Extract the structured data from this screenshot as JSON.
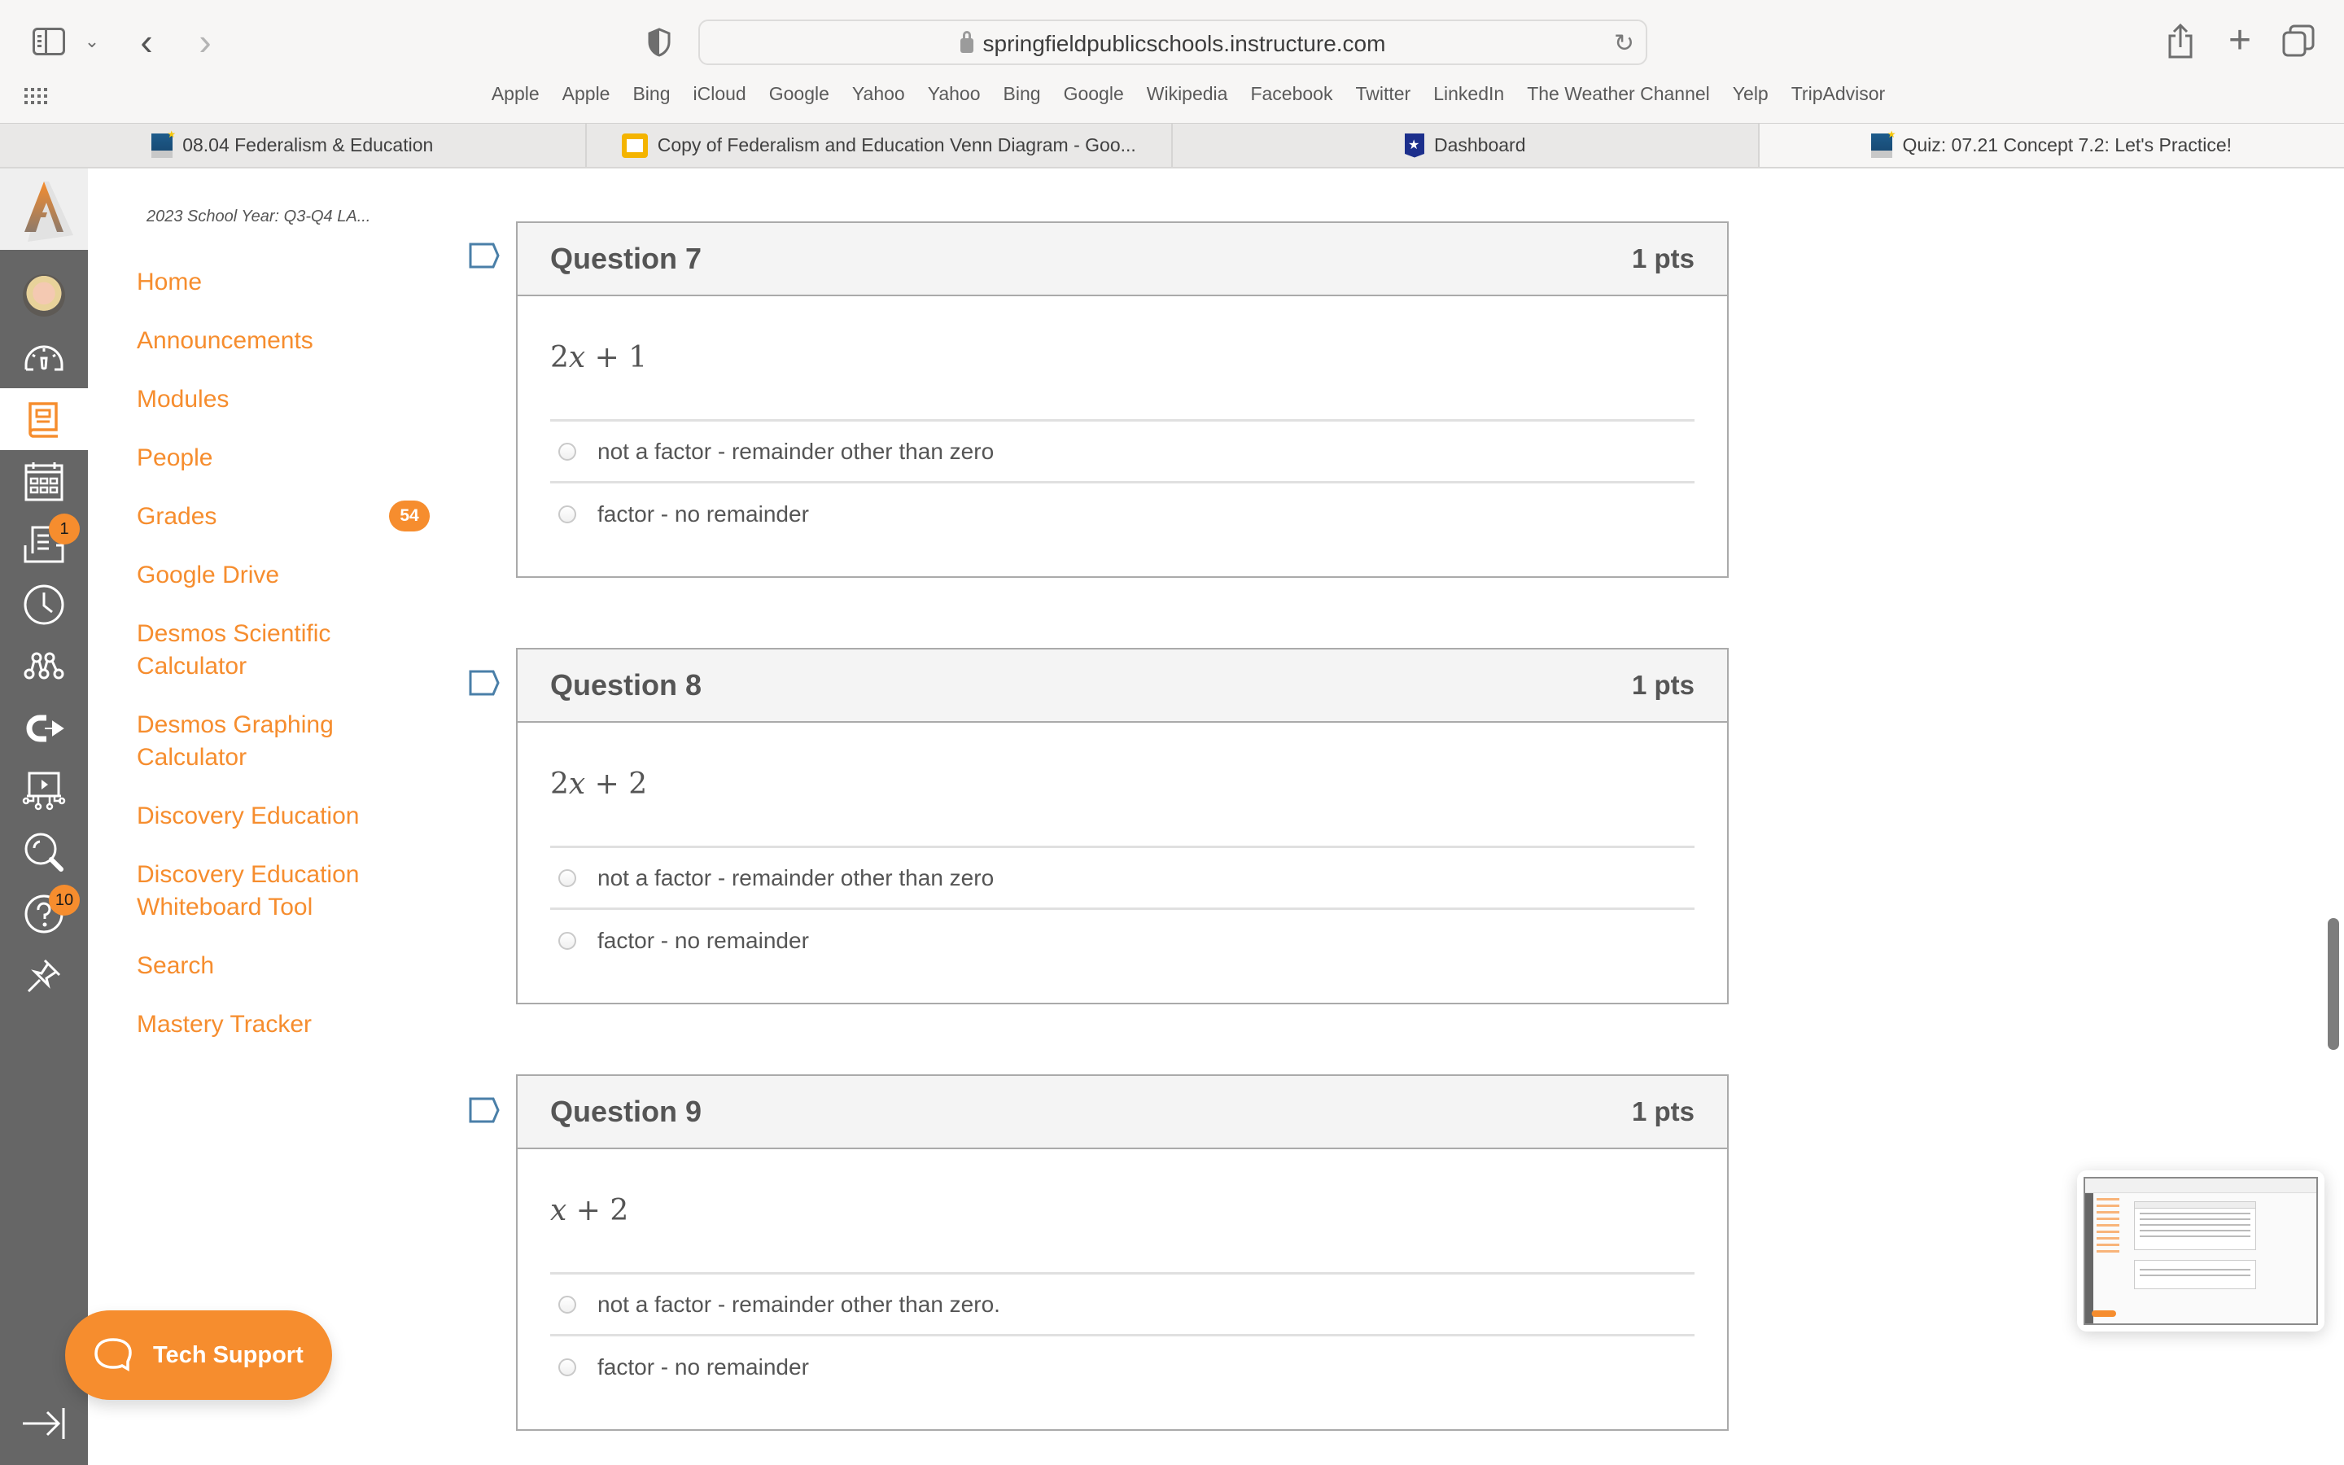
{
  "browser": {
    "url": "springfieldpublicschools.instructure.com",
    "bookmarks": [
      "Apple",
      "Apple",
      "Bing",
      "iCloud",
      "Google",
      "Yahoo",
      "Yahoo",
      "Bing",
      "Google",
      "Wikipedia",
      "Facebook",
      "Twitter",
      "LinkedIn",
      "The Weather Channel",
      "Yelp",
      "TripAdvisor"
    ],
    "tabs": [
      {
        "title": "08.04 Federalism & Education",
        "favicon": "springfield-schools-icon",
        "active": false
      },
      {
        "title": "Copy of Federalism and Education Venn Diagram - Goo...",
        "favicon": "google-slides-icon",
        "active": false
      },
      {
        "title": "Dashboard",
        "favicon": "canvas-shield-icon",
        "active": false
      },
      {
        "title": "Quiz: 07.21 Concept 7.2: Let's Practice!",
        "favicon": "springfield-schools-icon",
        "active": true
      }
    ]
  },
  "global_nav": {
    "items": [
      {
        "name": "account",
        "icon": "avatar"
      },
      {
        "name": "dashboard",
        "icon": "dashboard-gauge-icon"
      },
      {
        "name": "courses",
        "icon": "courses-book-icon",
        "active": true
      },
      {
        "name": "calendar",
        "icon": "calendar-icon"
      },
      {
        "name": "inbox",
        "icon": "inbox-icon",
        "badge": "1"
      },
      {
        "name": "history",
        "icon": "clock-icon"
      },
      {
        "name": "groups",
        "icon": "groups-icon"
      },
      {
        "name": "external-tool",
        "icon": "magnet-arrow-icon"
      },
      {
        "name": "studio",
        "icon": "studio-icon"
      },
      {
        "name": "search",
        "icon": "search-icon"
      },
      {
        "name": "help",
        "icon": "help-icon",
        "badge": "10"
      },
      {
        "name": "pin",
        "icon": "pin-icon"
      }
    ]
  },
  "course_nav": {
    "course_title": "2023 School Year: Q3-Q4 LA...",
    "items": [
      {
        "label": "Home"
      },
      {
        "label": "Announcements"
      },
      {
        "label": "Modules"
      },
      {
        "label": "People"
      },
      {
        "label": "Grades",
        "badge": "54"
      },
      {
        "label": "Google Drive"
      },
      {
        "label": "Desmos Scientific Calculator"
      },
      {
        "label": "Desmos Graphing Calculator"
      },
      {
        "label": "Discovery Education"
      },
      {
        "label": "Discovery Education Whiteboard Tool"
      },
      {
        "label": "Search"
      },
      {
        "label": "Mastery Tracker"
      }
    ]
  },
  "questions": [
    {
      "title": "Question 7",
      "points": "1 pts",
      "expression": {
        "coef": "2",
        "var": "x",
        "op": "+",
        "const": "1"
      },
      "answers": [
        "not a factor - remainder other than zero",
        "factor - no remainder"
      ]
    },
    {
      "title": "Question 8",
      "points": "1 pts",
      "expression": {
        "coef": "2",
        "var": "x",
        "op": "+",
        "const": "2"
      },
      "answers": [
        "not a factor - remainder other than zero",
        "factor - no remainder"
      ]
    },
    {
      "title": "Question 9",
      "points": "1 pts",
      "expression": {
        "coef": "",
        "var": "x",
        "op": "+",
        "const": "2"
      },
      "answers": [
        "not a factor - remainder other than zero.",
        "factor - no remainder"
      ]
    }
  ],
  "tech_support": {
    "label": "Tech Support"
  },
  "colors": {
    "brand_orange": "#f68d2e",
    "nav_gray": "#666666",
    "flag_blue": "#4a7fa8"
  }
}
